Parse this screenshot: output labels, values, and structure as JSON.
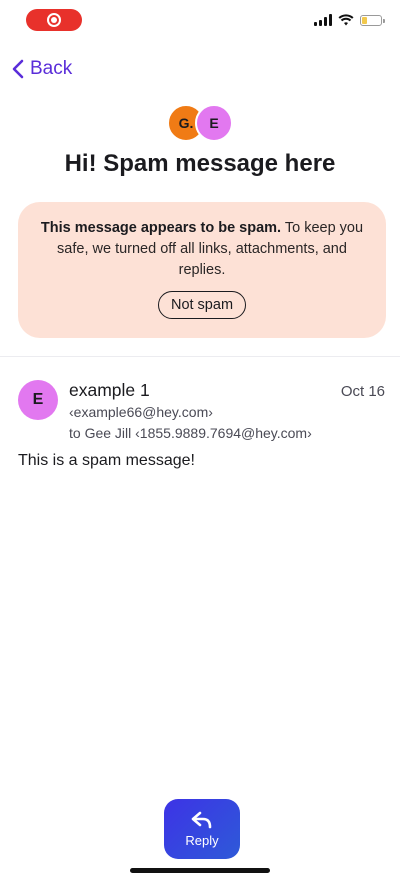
{
  "status_bar": {
    "record_indicator": "record-icon",
    "battery_color": "#f2c94c"
  },
  "nav": {
    "back_label": "Back"
  },
  "header": {
    "avatars": [
      "G.",
      "E"
    ],
    "title": "Hi! Spam message here"
  },
  "spam_banner": {
    "bold_text": "This message appears to be spam.",
    "text": "To keep you safe, we turned off all links, attachments, and replies.",
    "button_label": "Not spam",
    "background": "#fde1d6"
  },
  "message": {
    "avatar_letter": "E",
    "sender_name": "example 1",
    "sender_email": "‹example66@hey.com›",
    "recipient": "to Gee Jill ‹1855.9889.7694@hey.com›",
    "date": "Oct 16",
    "body": "This is a spam message!"
  },
  "reply": {
    "label": "Reply",
    "accent": "#3d33e6"
  }
}
